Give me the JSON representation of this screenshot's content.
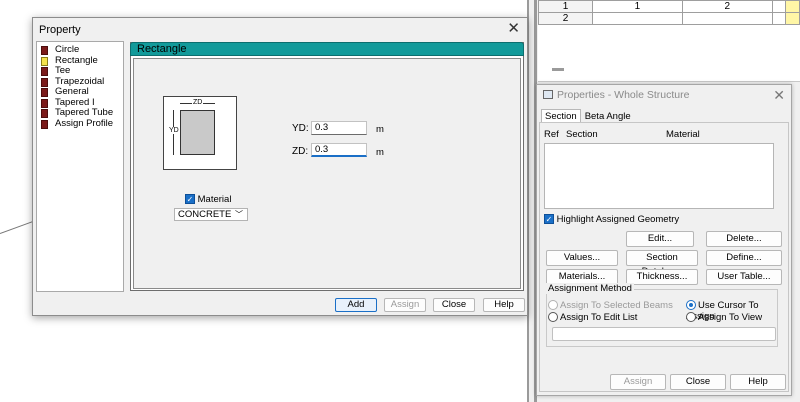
{
  "grid": {
    "row1": [
      "1",
      "1",
      "2",
      "",
      ""
    ],
    "row2": [
      "2",
      "",
      "",
      "",
      ""
    ]
  },
  "dialog": {
    "title": "Property",
    "tree": [
      "Circle",
      "Rectangle",
      "Tee",
      "Trapezoidal",
      "General",
      "Tapered I",
      "Tapered Tube",
      "Assign Profile"
    ],
    "selected": "Rectangle",
    "panel_title": "Rectangle",
    "dim_top": "ZD",
    "dim_side": "YD",
    "yd_label": "YD:",
    "yd_value": "0.3",
    "zd_label": "ZD:",
    "zd_value": "0.3",
    "unit": "m",
    "material_label": "Material",
    "material_value": "CONCRETE",
    "buttons": {
      "add": "Add",
      "assign": "Assign",
      "close": "Close",
      "help": "Help"
    }
  },
  "props": {
    "title": "Properties - Whole Structure",
    "tabs": [
      "Section",
      "Beta Angle"
    ],
    "col_ref": "Ref",
    "col_section": "Section",
    "col_material": "Material",
    "highlight": "Highlight Assigned Geometry",
    "buttons": {
      "edit": "Edit...",
      "delete": "Delete...",
      "values": "Values...",
      "section_db": "Section Database",
      "define": "Define...",
      "materials": "Materials...",
      "thickness": "Thickness...",
      "user_table": "User Table..."
    },
    "assign_method": "Assignment Method",
    "radio_selected_beams": "Assign To Selected Beams",
    "radio_cursor": "Use Cursor To Assign",
    "radio_edit_list": "Assign To Edit List",
    "radio_view": "Assign To View",
    "bottom": {
      "assign": "Assign",
      "close": "Close",
      "help": "Help"
    }
  },
  "colors": {
    "accent": "#1a6fc7",
    "panel_header": "#129a9a"
  }
}
